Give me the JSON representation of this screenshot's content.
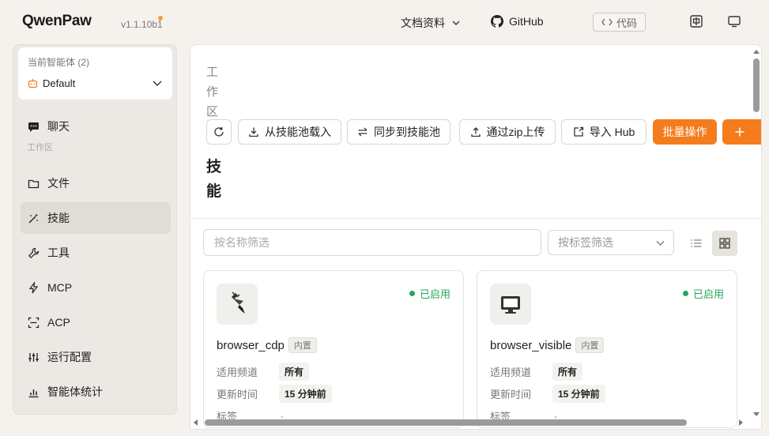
{
  "header": {
    "logo": "QwenPaw",
    "version": "v1.1.10b1",
    "docs_label": "文档资料",
    "github_label": "GitHub",
    "code_label": "代码",
    "icons": [
      "chevron-down-icon",
      "github-icon",
      "code-icon",
      "language-icon",
      "monitor-icon"
    ]
  },
  "sidebar": {
    "agent_title": "当前智能体 (2)",
    "agent_name": "Default",
    "chat_label": "聊天",
    "group_label": "工作区",
    "items": [
      {
        "label": "文件",
        "icon": "folder-icon"
      },
      {
        "label": "技能",
        "icon": "magic-wand-icon"
      },
      {
        "label": "工具",
        "icon": "wrench-icon"
      },
      {
        "label": "MCP",
        "icon": "lightning-icon"
      },
      {
        "label": "ACP",
        "icon": "scan-icon"
      },
      {
        "label": "运行配置",
        "icon": "sliders-icon"
      },
      {
        "label": "智能体统计",
        "icon": "bar-chart-icon"
      }
    ],
    "active_index": 1
  },
  "main": {
    "breadcrumb": "工作区",
    "title": "技能",
    "toolbar": {
      "load_pool": "从技能池载入",
      "sync_pool": "同步到技能池",
      "upload_zip": "通过zip上传",
      "import_hub": "导入 Hub",
      "batch": "批量操作"
    },
    "filter": {
      "name_placeholder": "按名称筛选",
      "tag_placeholder": "按标签筛选"
    },
    "cards": [
      {
        "name": "browser_cdp",
        "badge": "内置",
        "status": "已启用",
        "channel_label": "适用频道",
        "channel": "所有",
        "updated_label": "更新时间",
        "updated": "15 分钟前",
        "tags_label": "标签",
        "tags": "-",
        "icon": "plug-icon"
      },
      {
        "name": "browser_visible",
        "badge": "内置",
        "status": "已启用",
        "channel_label": "适用频道",
        "channel": "所有",
        "updated_label": "更新时间",
        "updated": "15 分钟前",
        "tags_label": "标签",
        "tags": "-",
        "icon": "monitor-icon"
      }
    ]
  },
  "colors": {
    "accent": "#f57c1c",
    "enabled": "#27a65b",
    "sidebar_bg": "#ece9e4"
  }
}
